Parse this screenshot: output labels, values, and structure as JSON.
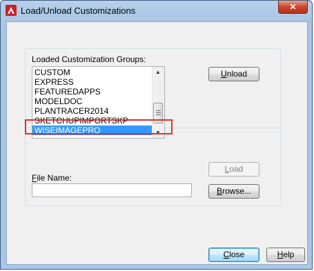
{
  "window": {
    "title": "Load/Unload Customizations",
    "close_glyph": "✕",
    "app_icon": "autocad-logo-icon"
  },
  "groups": {
    "label": "Loaded Customization Groups:",
    "items": [
      "CUSTOM",
      "EXPRESS",
      "FEATUREDAPPS",
      "MODELDOC",
      "PLANTRACER2014",
      "SKETCHUPIMPORTSKP",
      "WISEIMAGEPRO"
    ],
    "selected": "WISEIMAGEPRO",
    "highlight_color": "#d9312c",
    "selection_color": "#3399ff"
  },
  "buttons": {
    "unload_first": "U",
    "unload_rest": "nload",
    "load_first": "L",
    "load_rest": "oad",
    "browse_first": "B",
    "browse_rest": "rowse...",
    "close_first": "C",
    "close_rest": "lose",
    "help_first": "H",
    "help_rest": "elp"
  },
  "file": {
    "label_first": "F",
    "label_rest": "ile Name:",
    "value": ""
  }
}
